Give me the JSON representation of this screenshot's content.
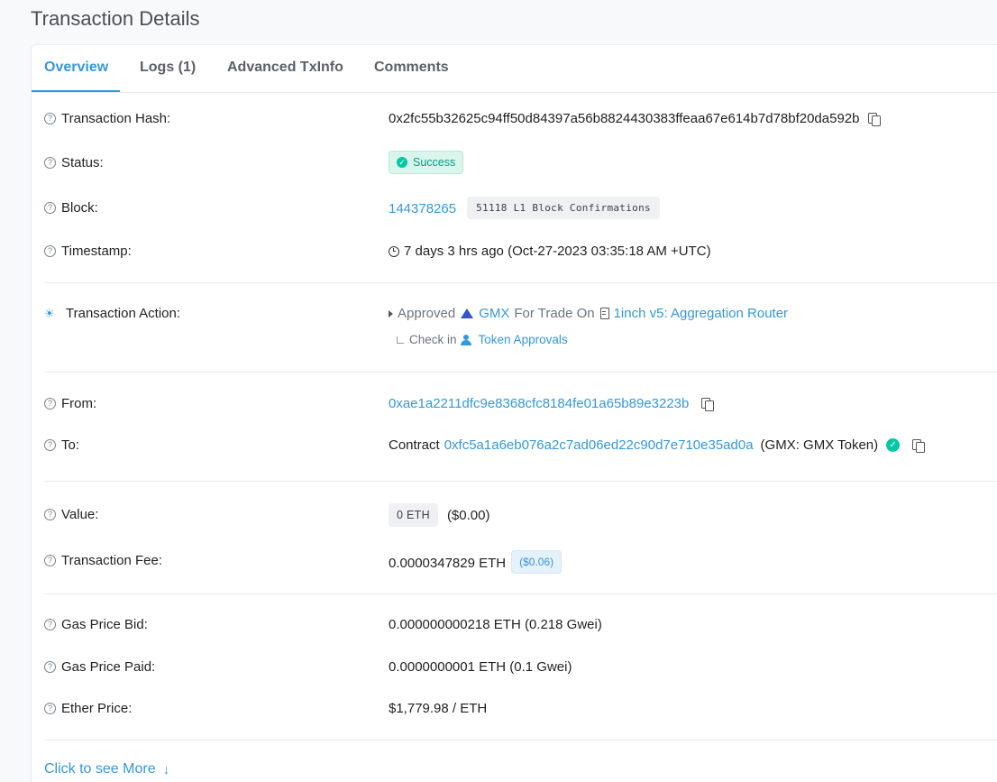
{
  "page": {
    "title": "Transaction Details"
  },
  "tabs": [
    {
      "label": "Overview"
    },
    {
      "label": "Logs (1)"
    },
    {
      "label": "Advanced TxInfo"
    },
    {
      "label": "Comments"
    }
  ],
  "fields": {
    "hash": {
      "label": "Transaction Hash:",
      "value": "0x2fc55b32625c94ff50d84397a56b8824430383ffeaa67e614b7d78bf20da592b"
    },
    "status": {
      "label": "Status:",
      "value": "Success"
    },
    "block": {
      "label": "Block:",
      "number": "144378265",
      "confirmations": "51118 L1 Block Confirmations"
    },
    "timestamp": {
      "label": "Timestamp:",
      "value": "7 days 3 hrs ago (Oct-27-2023 03:35:18 AM +UTC)"
    },
    "action": {
      "label": "Transaction Action:",
      "verb": "Approved",
      "token": "GMX",
      "for_trade_on": "For Trade On",
      "router": "1inch v5: Aggregation Router",
      "check_in": "Check in",
      "token_approvals": "Token Approvals"
    },
    "from": {
      "label": "From:",
      "value": "0xae1a2211dfc9e8368cfc8184fe01a65b89e3223b"
    },
    "to": {
      "label": "To:",
      "prefix": "Contract",
      "address": "0xfc5a1a6eb076a2c7ad06ed22c90d7e710e35ad0a",
      "name": "(GMX: GMX Token)"
    },
    "value": {
      "label": "Value:",
      "amount": "0 ETH",
      "usd": "($0.00)"
    },
    "fee": {
      "label": "Transaction Fee:",
      "amount": "0.0000347829 ETH",
      "usd": "($0.06)"
    },
    "gas_bid": {
      "label": "Gas Price Bid:",
      "value": "0.000000000218 ETH (0.218 Gwei)"
    },
    "gas_paid": {
      "label": "Gas Price Paid:",
      "value": "0.0000000001 ETH (0.1 Gwei)"
    },
    "ether_price": {
      "label": "Ether Price:",
      "value": "$1,779.98 / ETH"
    }
  },
  "see_more": {
    "label": "Click to see More"
  }
}
